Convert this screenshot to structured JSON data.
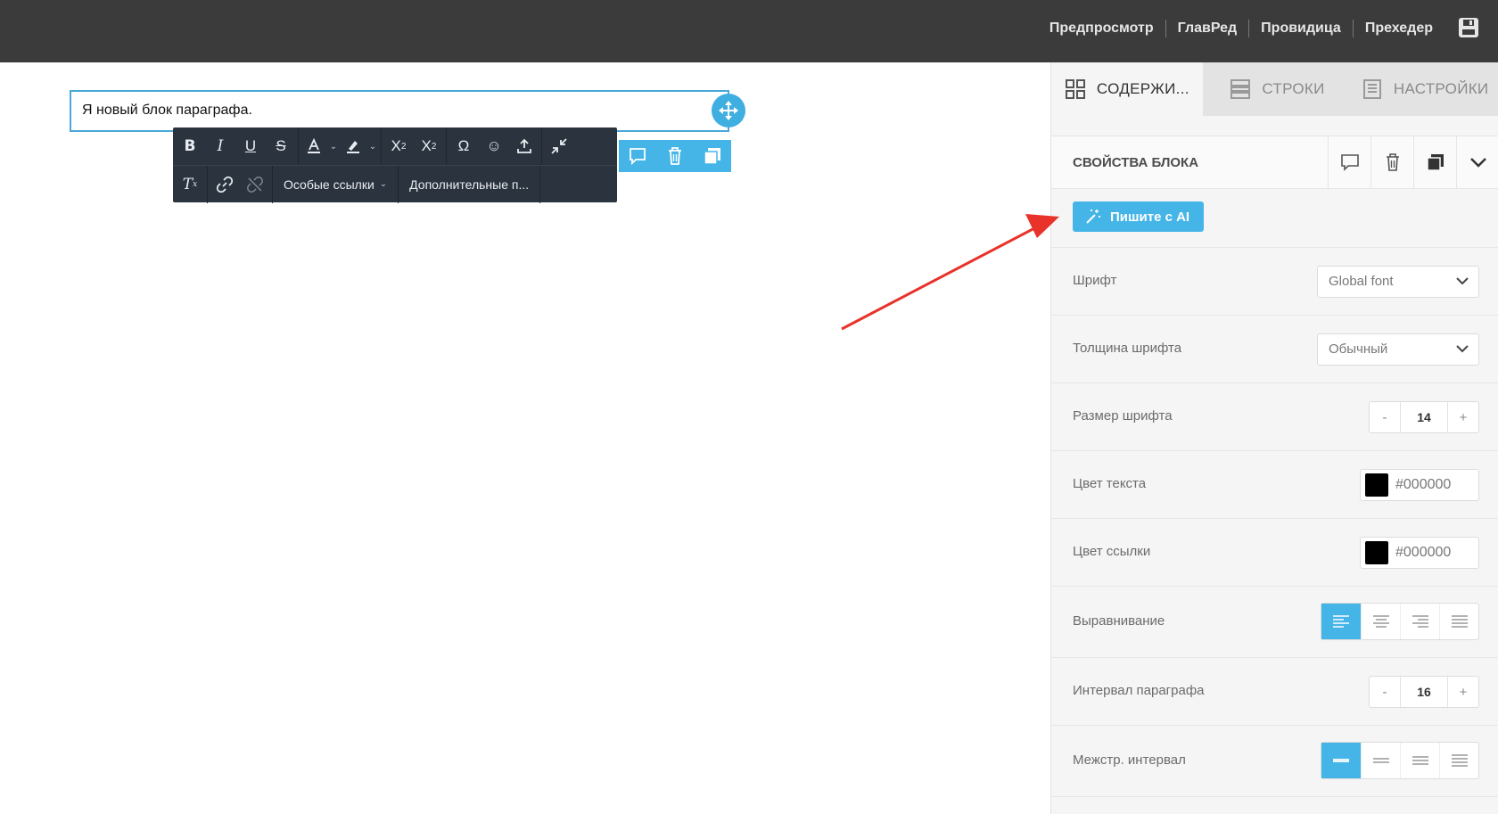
{
  "topbar": {
    "nav": [
      "Предпросмотр",
      "ГлавРед",
      "Провидица",
      "Прехедер"
    ],
    "save_icon": "save-icon"
  },
  "canvas": {
    "paragraph_text": "Я новый блок параграфа."
  },
  "toolbar": {
    "special_links": "Особые ссылки",
    "more": "Дополнительные п..."
  },
  "tabs": [
    {
      "label": "СОДЕРЖИ...",
      "icon": "grid-icon",
      "active": true
    },
    {
      "label": "СТРОКИ",
      "icon": "rows-icon",
      "active": false
    },
    {
      "label": "НАСТРОЙКИ",
      "icon": "settings-icon",
      "active": false
    }
  ],
  "properties": {
    "title": "СВОЙСТВА БЛОКА",
    "ai_button": "Пишите с AI",
    "font_label": "Шрифт",
    "font_value": "Global font",
    "weight_label": "Толщина шрифта",
    "weight_value": "Обычный",
    "size_label": "Размер шрифта",
    "size_value": "14",
    "minus": "-",
    "plus": "+",
    "text_color_label": "Цвет текста",
    "text_color_value": "#000000",
    "link_color_label": "Цвет ссылки",
    "link_color_value": "#000000",
    "align_label": "Выравнивание",
    "paragraph_spacing_label": "Интервал параграфа",
    "paragraph_spacing_value": "16",
    "line_height_label": "Межстр. интервал"
  },
  "colors": {
    "accent": "#45b5e8",
    "topbar": "#3b3b3b",
    "toolbar": "#2b333f",
    "annotation_arrow": "#e8322a"
  }
}
